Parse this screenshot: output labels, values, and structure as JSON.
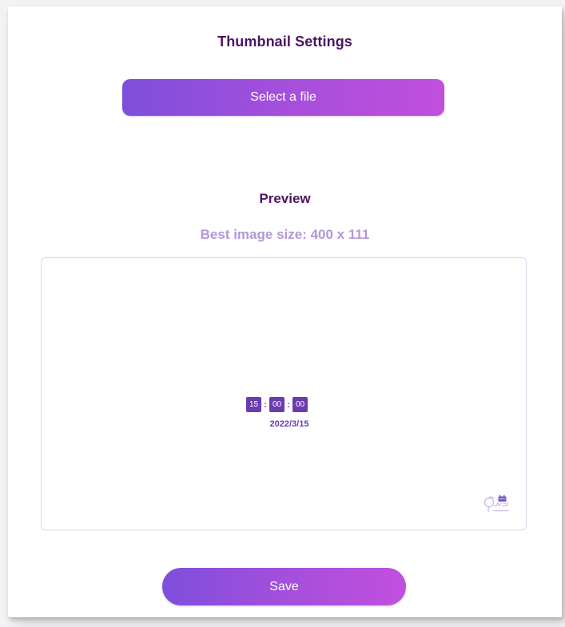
{
  "panel": {
    "title": "Thumbnail Settings"
  },
  "file_picker": {
    "button_label": "Select a file"
  },
  "preview": {
    "title": "Preview",
    "size_hint": "Best image size: 400 x 111",
    "clock": {
      "hours": "15",
      "minutes": "00",
      "seconds": "00",
      "separator": ":"
    },
    "date": "2022/3/15",
    "watermark_icon": "smart-scheduler-logo-icon"
  },
  "actions": {
    "save_label": "Save"
  },
  "colors": {
    "title": "#4b1460",
    "hint": "#b397d8",
    "accent_start": "#7d4fdb",
    "accent_end": "#c24fdd",
    "clock": "#6a3bb1",
    "border": "#ddd6ea"
  }
}
